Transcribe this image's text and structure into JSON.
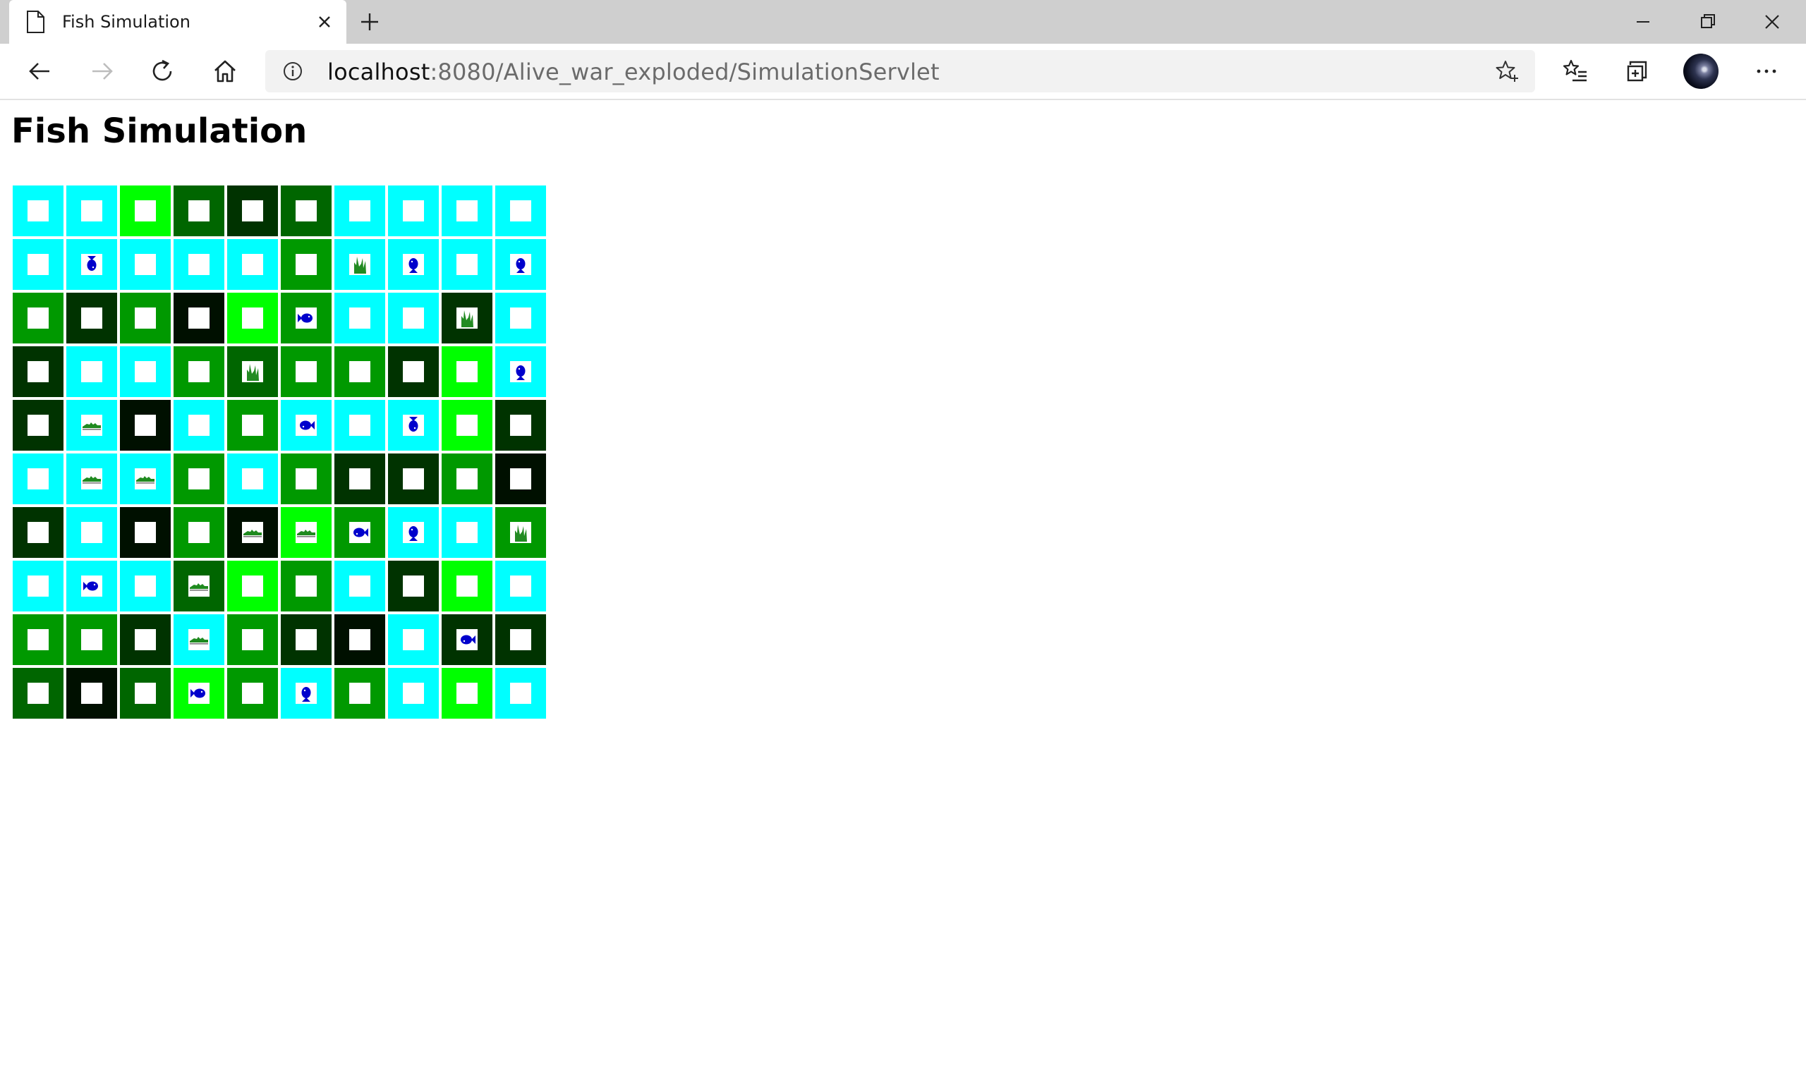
{
  "browser": {
    "tab_title": "Fish Simulation",
    "url_host": "localhost",
    "url_path": ":8080/Alive_war_exploded/SimulationServlet",
    "icons": {
      "tab": "page-icon",
      "tab_close": "close-icon",
      "new_tab": "plus-icon",
      "minimize": "minimize-icon",
      "restore": "restore-icon",
      "close": "close-icon",
      "back": "back-arrow-icon",
      "forward": "forward-arrow-icon",
      "refresh": "refresh-icon",
      "home": "home-icon",
      "site_info": "info-icon",
      "add_favorite": "star-add-icon",
      "favorites": "favorites-icon",
      "collections": "collections-icon",
      "profile": "avatar",
      "more": "more-icon"
    }
  },
  "page": {
    "title": "Fish Simulation"
  },
  "legend_colors": {
    "C": "#00ffff",
    "L": "#00ff00",
    "M": "#009900",
    "D": "#006600",
    "V": "#003300",
    "K": "#001000"
  },
  "entity_colors": {
    "fish": "#0000cc",
    "plant": "#228b22",
    "croc": "#1f8a1f"
  },
  "grid": [
    [
      "C",
      "C",
      "L",
      "D",
      "V",
      "D",
      "C",
      "C",
      "C",
      "C"
    ],
    [
      "C",
      "C:fish-down",
      "C",
      "C",
      "C",
      "M",
      "C:plant",
      "C:fish-up",
      "C",
      "C:fish-up"
    ],
    [
      "M",
      "V",
      "M",
      "K",
      "L",
      "M:fish-right",
      "C",
      "C",
      "V:plant",
      "C"
    ],
    [
      "V",
      "C",
      "C",
      "M",
      "D:plant",
      "M",
      "M",
      "V",
      "L",
      "C:fish-up"
    ],
    [
      "V",
      "C:croc",
      "K",
      "C",
      "M",
      "C:fish-left",
      "C",
      "C:fish-down",
      "L",
      "V"
    ],
    [
      "C",
      "C:croc",
      "C:croc",
      "M",
      "C",
      "M",
      "V",
      "V",
      "M",
      "K"
    ],
    [
      "V",
      "C",
      "K",
      "M",
      "K:croc",
      "L:croc",
      "M:fish-left",
      "C:fish-up",
      "C",
      "M:plant"
    ],
    [
      "C",
      "C:fish-right",
      "C",
      "D:croc",
      "L",
      "M",
      "C",
      "V",
      "L",
      "C"
    ],
    [
      "M",
      "M",
      "V",
      "C:croc",
      "M",
      "V",
      "K",
      "C",
      "V:fish-left",
      "V"
    ],
    [
      "D",
      "K",
      "D",
      "L:fish-right",
      "M",
      "C:fish-up",
      "M",
      "C",
      "L",
      "C"
    ]
  ]
}
